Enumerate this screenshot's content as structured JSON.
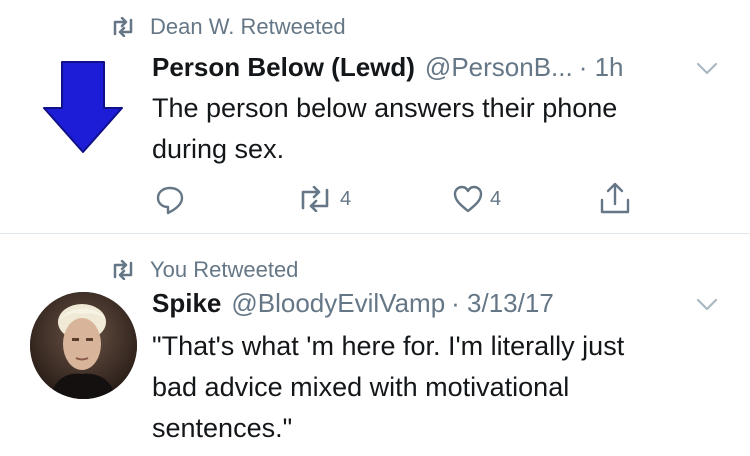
{
  "tweets": [
    {
      "retweeted_by": "Dean W. Retweeted",
      "name": "Person Below (Lewd)",
      "handle": "@PersonB...",
      "time": "· 1h",
      "text_lines": [
        "The person below answers their phone",
        "during sex."
      ],
      "actions": {
        "reply_count": "",
        "retweet_count": "4",
        "like_count": "4"
      },
      "icons": [
        "retweet-icon",
        "down-arrow-icon",
        "chevron-down-icon",
        "reply-icon",
        "retweet-icon",
        "heart-icon",
        "share-icon"
      ]
    },
    {
      "retweeted_by": "You Retweeted",
      "name": "Spike",
      "handle": "@BloodyEvilVamp",
      "time": "· 3/13/17",
      "text_lines": [
        "\"That's what 'm here for. I'm literally just",
        "bad advice mixed with motivational",
        "sentences.\""
      ],
      "icons": [
        "retweet-icon",
        "avatar",
        "chevron-down-icon"
      ]
    }
  ],
  "colors": {
    "accent_blue": "#1d1dd8",
    "muted_gray": "#657786",
    "divider": "#e1e8ed"
  }
}
